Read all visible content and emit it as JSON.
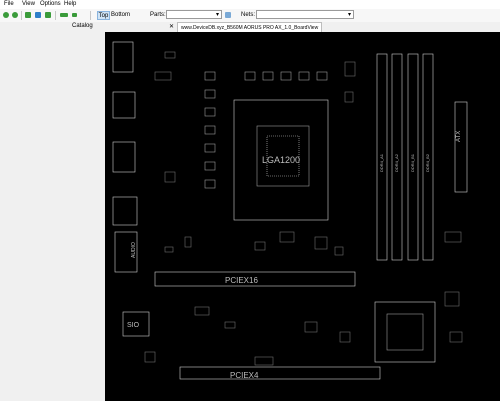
{
  "menu": {
    "file": "File",
    "view": "View",
    "options": "Options",
    "help": "Help"
  },
  "toolbar": {
    "top_label": "Top",
    "bottom_label": "Bottom",
    "parts_label": "Parts:",
    "parts_value": "",
    "nets_label": "Nets:",
    "nets_value": "",
    "icons": [
      "back-icon",
      "forward-icon",
      "zoom-in-icon",
      "zoom-fit-icon",
      "zoom-out-icon",
      "rotate-icon",
      "search-icon"
    ]
  },
  "panel": {
    "catalog_label": "Catalog"
  },
  "tab": {
    "close": "✕",
    "title": "www.DeviceDB.xyz_B560M AORUS PRO AX_1.0_BoardView"
  },
  "board": {
    "labels": [
      "LGA1200",
      "PCIEX16",
      "PCIEX4",
      "SIO",
      "AUDIO",
      "ATX",
      "DDR4_A1",
      "DDR4_A2",
      "DDR4_B1",
      "DDR4_B2"
    ],
    "colors": {
      "background": "#000000",
      "outline": "#cfcfcf",
      "accent": "#9c9c9c"
    }
  }
}
